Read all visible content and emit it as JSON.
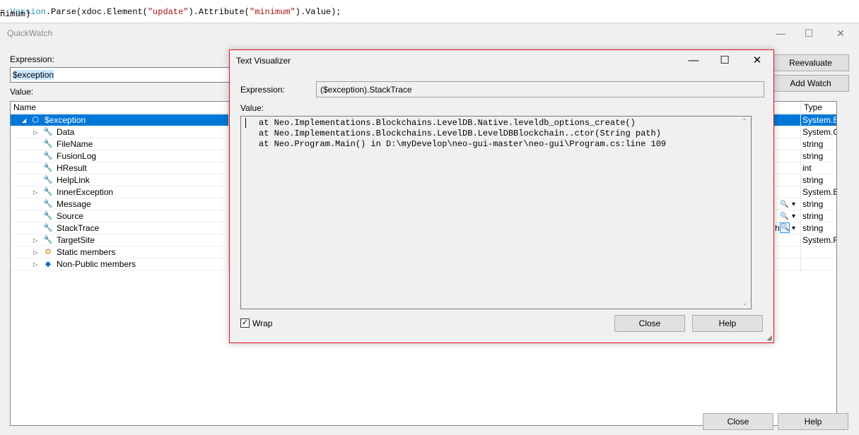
{
  "editor": {
    "line1": [
      "= ",
      "Version",
      ".Parse(xdoc.Element(",
      "\"update\"",
      ").Attribute(",
      "\"minimum\"",
      ").Value);"
    ],
    "line2": "nimum)"
  },
  "quickwatch": {
    "title": "QuickWatch",
    "controls": {
      "minimize": "—",
      "maximize": "☐",
      "close": "✕"
    },
    "expression_label": "Expression:",
    "expression_value": "$exception",
    "value_label": "Value:",
    "reevaluate_label": "Reevaluate",
    "add_watch_label": "Add Watch",
    "close_label": "Close",
    "help_label": "Help",
    "columns": {
      "name": "Name",
      "type": "Type"
    },
    "rows": [
      {
        "name": "$exception",
        "type": "System.E",
        "expander": "◢",
        "icon": "object-icon",
        "glyph": "⬡",
        "selected": true
      },
      {
        "name": "Data",
        "type": "System.C",
        "expander": "▷",
        "icon": "wrench-icon",
        "glyph": "🔧"
      },
      {
        "name": "FileName",
        "type": "string",
        "expander": "",
        "icon": "wrench-icon",
        "glyph": "🔧"
      },
      {
        "name": "FusionLog",
        "type": "string",
        "expander": "",
        "icon": "wrench-icon",
        "glyph": "🔧"
      },
      {
        "name": "HResult",
        "type": "int",
        "expander": "",
        "icon": "wrench-icon",
        "glyph": "🔧"
      },
      {
        "name": "HelpLink",
        "type": "string",
        "expander": "",
        "icon": "wrench-icon",
        "glyph": "🔧"
      },
      {
        "name": "InnerException",
        "type": "System.E",
        "expander": "▷",
        "icon": "wrench-icon",
        "glyph": "🔧"
      },
      {
        "name": "Message",
        "type": "string",
        "expander": "",
        "icon": "wrench-icon",
        "glyph": "🔧",
        "viz": true
      },
      {
        "name": "Source",
        "type": "string",
        "expander": "",
        "icon": "wrench-icon",
        "glyph": "🔧",
        "viz": true
      },
      {
        "name": "StackTrace",
        "type": "string",
        "expander": "",
        "icon": "wrench-icon",
        "glyph": "🔧",
        "viz": true,
        "vizActive": true
      },
      {
        "name": "TargetSite",
        "type": "System.R",
        "expander": "▷",
        "icon": "wrench-icon",
        "glyph": "🔧"
      },
      {
        "name": "Static members",
        "type": "",
        "expander": "▷",
        "icon": "static-members-icon",
        "glyph": "⚙"
      },
      {
        "name": "Non-Public members",
        "type": "",
        "expander": "▷",
        "icon": "private-members-icon",
        "glyph": "◆"
      }
    ],
    "visible_value_fragment": "h",
    "magnifier_glyph": "🔍",
    "dropdown_glyph": "▾"
  },
  "text_visualizer": {
    "title": "Text Visualizer",
    "controls": {
      "minimize": "—",
      "maximize": "☐",
      "close": "✕"
    },
    "expression_label": "Expression:",
    "expression_value": "($exception).StackTrace",
    "value_label": "Value:",
    "stack_trace": [
      "at Neo.Implementations.Blockchains.LevelDB.Native.leveldb_options_create()",
      "at Neo.Implementations.Blockchains.LevelDB.LevelDBBlockchain..ctor(String path)",
      "at Neo.Program.Main() in D:\\myDevelop\\neo-gui-master\\neo-gui\\Program.cs:line 109"
    ],
    "wrap_label": "Wrap",
    "wrap_checked": true,
    "close_label": "Close",
    "help_label": "Help"
  },
  "colors": {
    "selection": "#0078d7",
    "dialog_border": "#e81123",
    "code_type": "#2b91af",
    "code_string": "#a31515"
  }
}
